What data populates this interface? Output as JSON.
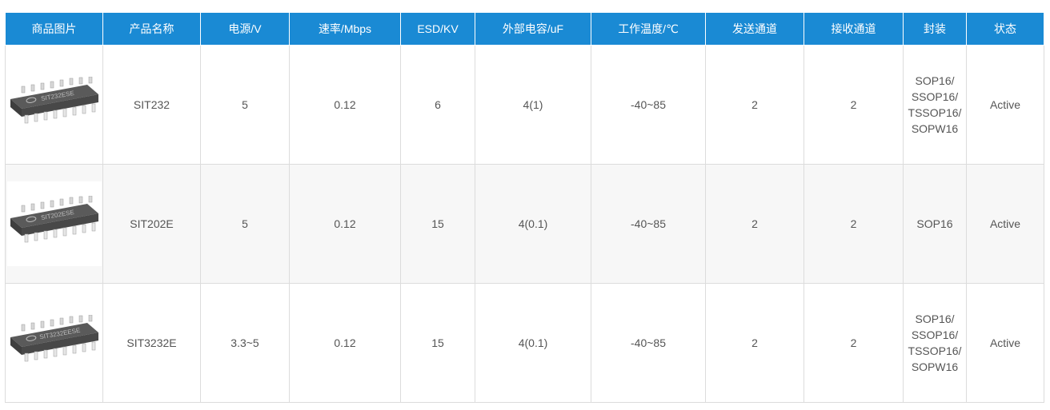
{
  "table": {
    "headers": [
      "商品图片",
      "产品名称",
      "电源/V",
      "速率/Mbps",
      "ESD/KV",
      "外部电容/uF",
      "工作温度/℃",
      "发送通道",
      "接收通道",
      "封装",
      "状态"
    ],
    "rows": [
      {
        "image_label": "SIT232ESE",
        "name": "SIT232",
        "power": "5",
        "rate": "0.12",
        "esd": "6",
        "capacitor": "4(1)",
        "temp": "-40~85",
        "tx": "2",
        "rx": "2",
        "package": "SOP16/\nSSOP16/\nTSSOP16/\nSOPW16",
        "status": "Active"
      },
      {
        "image_label": "SIT202ESE",
        "name": "SIT202E",
        "power": "5",
        "rate": "0.12",
        "esd": "15",
        "capacitor": "4(0.1)",
        "temp": "-40~85",
        "tx": "2",
        "rx": "2",
        "package": "SOP16",
        "status": "Active"
      },
      {
        "image_label": "SIT3232EESE",
        "name": "SIT3232E",
        "power": "3.3~5",
        "rate": "0.12",
        "esd": "15",
        "capacitor": "4(0.1)",
        "temp": "-40~85",
        "tx": "2",
        "rx": "2",
        "package": "SOP16/\nSSOP16/\nTSSOP16/\nSOPW16",
        "status": "Active"
      }
    ]
  },
  "colors": {
    "header_bg": "#1a8ad4",
    "header_text": "#ffffff",
    "cell_text": "#555555",
    "grid": "#dcdcdc",
    "alt_row": "#f7f7f7"
  },
  "icons": {
    "product_image": "soic16-chip-icon",
    "chip_logo": "sit-logo-icon"
  }
}
